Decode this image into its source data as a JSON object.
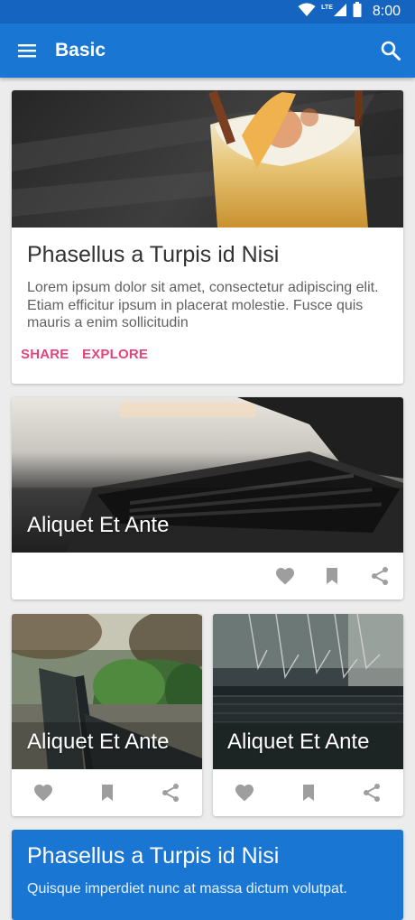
{
  "colors": {
    "status_bar": "#1565c0",
    "app_bar": "#1976d2",
    "accent": "#e2457c",
    "icon_gray": "#9e9e9e",
    "background": "#ececec"
  },
  "status_bar": {
    "time": "8:00",
    "network_label": "LTE",
    "icons": [
      "wifi-icon",
      "cell-signal-icon",
      "battery-icon"
    ]
  },
  "app_bar": {
    "title": "Basic",
    "nav_icon": "menu-icon",
    "action_icon": "search-icon"
  },
  "cards": [
    {
      "title": "Phasellus a Turpis id Nisi",
      "body": "Lorem ipsum dolor sit amet, consectetur adipiscing elit. Etiam efficitur ipsum in placerat molestie.  Fusce quis mauris a enim sollicitudin",
      "buttons": [
        "SHARE",
        "EXPLORE"
      ]
    },
    {
      "title": "Aliquet Et Ante",
      "actions": [
        "favorite-icon",
        "bookmark-icon",
        "share-icon"
      ]
    },
    {
      "title": "Aliquet Et Ante",
      "actions": [
        "favorite-icon",
        "bookmark-icon",
        "share-icon"
      ]
    },
    {
      "title": "Aliquet Et Ante",
      "actions": [
        "favorite-icon",
        "bookmark-icon",
        "share-icon"
      ]
    },
    {
      "title": "Phasellus a Turpis id Nisi",
      "subtitle": "Quisque imperdiet nunc at massa dictum volutpat."
    }
  ]
}
